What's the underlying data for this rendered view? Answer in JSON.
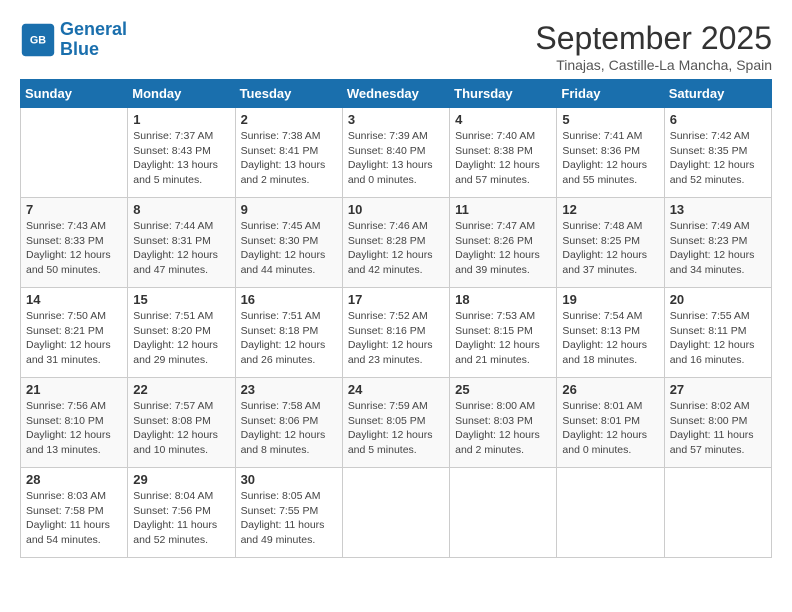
{
  "header": {
    "logo_line1": "General",
    "logo_line2": "Blue",
    "month": "September 2025",
    "location": "Tinajas, Castille-La Mancha, Spain"
  },
  "weekdays": [
    "Sunday",
    "Monday",
    "Tuesday",
    "Wednesday",
    "Thursday",
    "Friday",
    "Saturday"
  ],
  "weeks": [
    [
      {
        "day": "",
        "info": ""
      },
      {
        "day": "1",
        "info": "Sunrise: 7:37 AM\nSunset: 8:43 PM\nDaylight: 13 hours\nand 5 minutes."
      },
      {
        "day": "2",
        "info": "Sunrise: 7:38 AM\nSunset: 8:41 PM\nDaylight: 13 hours\nand 2 minutes."
      },
      {
        "day": "3",
        "info": "Sunrise: 7:39 AM\nSunset: 8:40 PM\nDaylight: 13 hours\nand 0 minutes."
      },
      {
        "day": "4",
        "info": "Sunrise: 7:40 AM\nSunset: 8:38 PM\nDaylight: 12 hours\nand 57 minutes."
      },
      {
        "day": "5",
        "info": "Sunrise: 7:41 AM\nSunset: 8:36 PM\nDaylight: 12 hours\nand 55 minutes."
      },
      {
        "day": "6",
        "info": "Sunrise: 7:42 AM\nSunset: 8:35 PM\nDaylight: 12 hours\nand 52 minutes."
      }
    ],
    [
      {
        "day": "7",
        "info": "Sunrise: 7:43 AM\nSunset: 8:33 PM\nDaylight: 12 hours\nand 50 minutes."
      },
      {
        "day": "8",
        "info": "Sunrise: 7:44 AM\nSunset: 8:31 PM\nDaylight: 12 hours\nand 47 minutes."
      },
      {
        "day": "9",
        "info": "Sunrise: 7:45 AM\nSunset: 8:30 PM\nDaylight: 12 hours\nand 44 minutes."
      },
      {
        "day": "10",
        "info": "Sunrise: 7:46 AM\nSunset: 8:28 PM\nDaylight: 12 hours\nand 42 minutes."
      },
      {
        "day": "11",
        "info": "Sunrise: 7:47 AM\nSunset: 8:26 PM\nDaylight: 12 hours\nand 39 minutes."
      },
      {
        "day": "12",
        "info": "Sunrise: 7:48 AM\nSunset: 8:25 PM\nDaylight: 12 hours\nand 37 minutes."
      },
      {
        "day": "13",
        "info": "Sunrise: 7:49 AM\nSunset: 8:23 PM\nDaylight: 12 hours\nand 34 minutes."
      }
    ],
    [
      {
        "day": "14",
        "info": "Sunrise: 7:50 AM\nSunset: 8:21 PM\nDaylight: 12 hours\nand 31 minutes."
      },
      {
        "day": "15",
        "info": "Sunrise: 7:51 AM\nSunset: 8:20 PM\nDaylight: 12 hours\nand 29 minutes."
      },
      {
        "day": "16",
        "info": "Sunrise: 7:51 AM\nSunset: 8:18 PM\nDaylight: 12 hours\nand 26 minutes."
      },
      {
        "day": "17",
        "info": "Sunrise: 7:52 AM\nSunset: 8:16 PM\nDaylight: 12 hours\nand 23 minutes."
      },
      {
        "day": "18",
        "info": "Sunrise: 7:53 AM\nSunset: 8:15 PM\nDaylight: 12 hours\nand 21 minutes."
      },
      {
        "day": "19",
        "info": "Sunrise: 7:54 AM\nSunset: 8:13 PM\nDaylight: 12 hours\nand 18 minutes."
      },
      {
        "day": "20",
        "info": "Sunrise: 7:55 AM\nSunset: 8:11 PM\nDaylight: 12 hours\nand 16 minutes."
      }
    ],
    [
      {
        "day": "21",
        "info": "Sunrise: 7:56 AM\nSunset: 8:10 PM\nDaylight: 12 hours\nand 13 minutes."
      },
      {
        "day": "22",
        "info": "Sunrise: 7:57 AM\nSunset: 8:08 PM\nDaylight: 12 hours\nand 10 minutes."
      },
      {
        "day": "23",
        "info": "Sunrise: 7:58 AM\nSunset: 8:06 PM\nDaylight: 12 hours\nand 8 minutes."
      },
      {
        "day": "24",
        "info": "Sunrise: 7:59 AM\nSunset: 8:05 PM\nDaylight: 12 hours\nand 5 minutes."
      },
      {
        "day": "25",
        "info": "Sunrise: 8:00 AM\nSunset: 8:03 PM\nDaylight: 12 hours\nand 2 minutes."
      },
      {
        "day": "26",
        "info": "Sunrise: 8:01 AM\nSunset: 8:01 PM\nDaylight: 12 hours\nand 0 minutes."
      },
      {
        "day": "27",
        "info": "Sunrise: 8:02 AM\nSunset: 8:00 PM\nDaylight: 11 hours\nand 57 minutes."
      }
    ],
    [
      {
        "day": "28",
        "info": "Sunrise: 8:03 AM\nSunset: 7:58 PM\nDaylight: 11 hours\nand 54 minutes."
      },
      {
        "day": "29",
        "info": "Sunrise: 8:04 AM\nSunset: 7:56 PM\nDaylight: 11 hours\nand 52 minutes."
      },
      {
        "day": "30",
        "info": "Sunrise: 8:05 AM\nSunset: 7:55 PM\nDaylight: 11 hours\nand 49 minutes."
      },
      {
        "day": "",
        "info": ""
      },
      {
        "day": "",
        "info": ""
      },
      {
        "day": "",
        "info": ""
      },
      {
        "day": "",
        "info": ""
      }
    ]
  ]
}
